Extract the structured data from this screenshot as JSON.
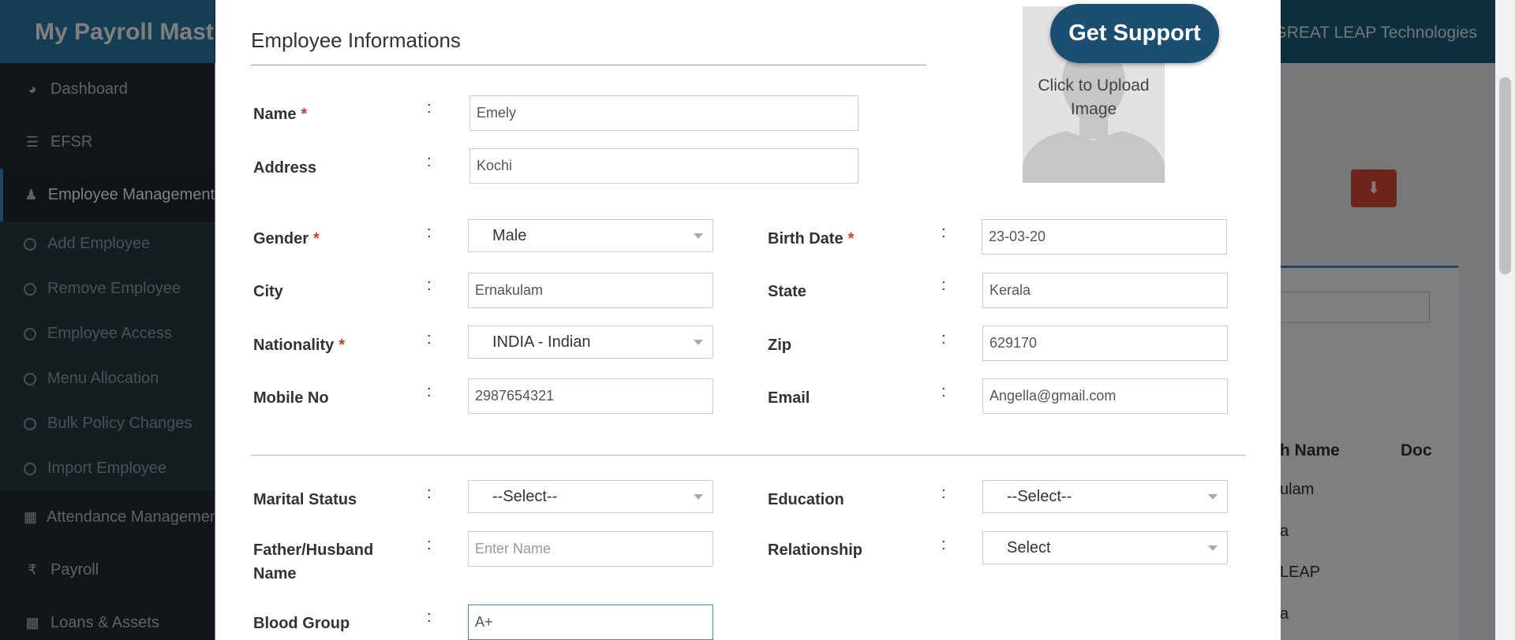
{
  "app": {
    "title": "My Payroll Master",
    "company": "GREAT LEAP Technologies"
  },
  "sidebar": {
    "items": [
      {
        "label": "Dashboard",
        "icon": "dashboard-icon"
      },
      {
        "label": "EFSR",
        "icon": "list-icon"
      },
      {
        "label": "Employee Management",
        "icon": "user-plus-icon"
      }
    ],
    "sub_items": [
      {
        "label": "Add Employee"
      },
      {
        "label": "Remove Employee"
      },
      {
        "label": "Employee Access"
      },
      {
        "label": "Menu Allocation"
      },
      {
        "label": "Bulk Policy Changes"
      },
      {
        "label": "Import Employee"
      }
    ],
    "items_after": [
      {
        "label": "Attendance Management",
        "icon": "calendar-icon"
      },
      {
        "label": "Payroll",
        "icon": "rupee-icon"
      },
      {
        "label": "Loans & Assets",
        "icon": "money-icon"
      }
    ]
  },
  "background_table": {
    "col_name": "h Name",
    "col_doc": "Doc",
    "rows": [
      "ulam",
      "a",
      "LEAP",
      "a"
    ]
  },
  "modal": {
    "title": "Employee Informations",
    "support_label": "Get Support",
    "upload_label": "Click to Upload Image",
    "colon": ":",
    "required_mark": "*",
    "fields": {
      "name": {
        "label": "Name",
        "value": "Emely"
      },
      "address": {
        "label": "Address",
        "value": "Kochi"
      },
      "gender": {
        "label": "Gender",
        "value": "Male"
      },
      "birth_date": {
        "label": "Birth Date",
        "value": "23-03-20"
      },
      "city": {
        "label": "City",
        "value": "Ernakulam"
      },
      "state": {
        "label": "State",
        "value": "Kerala"
      },
      "nationality": {
        "label": "Nationality",
        "value": "INDIA - Indian"
      },
      "zip": {
        "label": "Zip",
        "value": "629170"
      },
      "mobile": {
        "label": "Mobile No",
        "value": "2987654321"
      },
      "email": {
        "label": "Email",
        "value": "Angella@gmail.com"
      },
      "marital_status": {
        "label": "Marital Status",
        "value": "--Select--"
      },
      "education": {
        "label": "Education",
        "value": "--Select--"
      },
      "father_husband": {
        "label": "Father/Husband Name",
        "placeholder": "Enter Name"
      },
      "relationship": {
        "label": "Relationship",
        "value": "Select"
      },
      "blood_group": {
        "label": "Blood Group",
        "value": "A+"
      }
    }
  }
}
